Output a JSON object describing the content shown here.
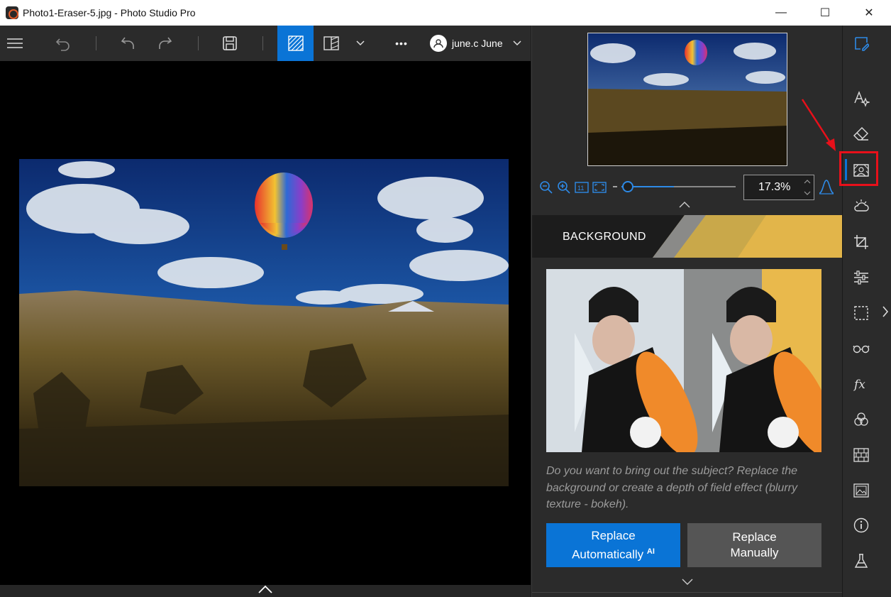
{
  "window": {
    "title": "Photo1-Eraser-5.jpg - Photo Studio Pro",
    "minimize": "—",
    "maximize": "☐",
    "close": "✕"
  },
  "toolbar": {
    "user_label": "june.c June",
    "more_label": "•••"
  },
  "navigator": {
    "zoom_value": "17.3%"
  },
  "section": {
    "title": "BACKGROUND",
    "description": "Do you want to bring out the subject? Replace the background or create a depth of field effect (blurry texture - bokeh).",
    "btn_auto_line1": "Replace",
    "btn_auto_line2": "Automatically",
    "btn_auto_badge": "AI",
    "btn_manual_line1": "Replace",
    "btn_manual_line2": "Manually"
  },
  "colors": {
    "accent": "#0a74d6",
    "highlight": "#e8101a",
    "panel_bg": "#2b2b2b"
  }
}
